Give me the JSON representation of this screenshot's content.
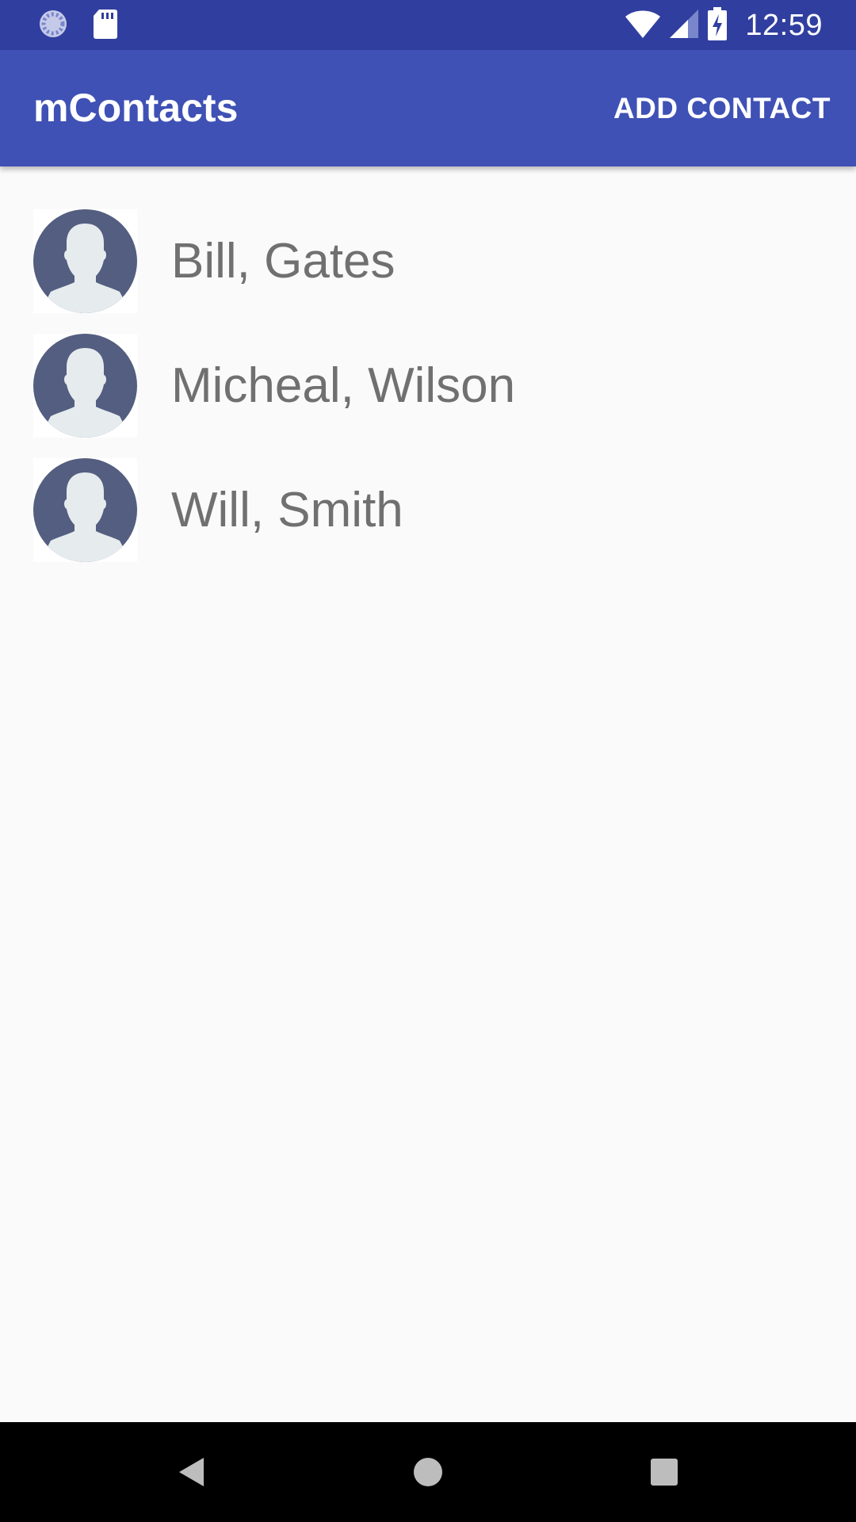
{
  "status_bar": {
    "time": "12:59",
    "icons": [
      "sync-icon",
      "sd-card-icon",
      "wifi-icon",
      "cell-signal-icon",
      "battery-charging-icon"
    ]
  },
  "app_bar": {
    "title": "mContacts",
    "add_contact_label": "ADD CONTACT"
  },
  "contacts": [
    {
      "name": "Bill, Gates",
      "avatar": "person-avatar-icon"
    },
    {
      "name": "Micheal, Wilson",
      "avatar": "person-avatar-icon"
    },
    {
      "name": "Will, Smith",
      "avatar": "person-avatar-icon"
    }
  ],
  "nav_bar": {
    "icons": [
      "back-icon",
      "home-icon",
      "recents-icon"
    ]
  },
  "colors": {
    "status_bar": "#303f9f",
    "app_bar": "#3f51b5",
    "background": "#fafafa",
    "avatar_circle": "#535e80",
    "avatar_person": "#e6ebee",
    "name_text": "#707070"
  }
}
